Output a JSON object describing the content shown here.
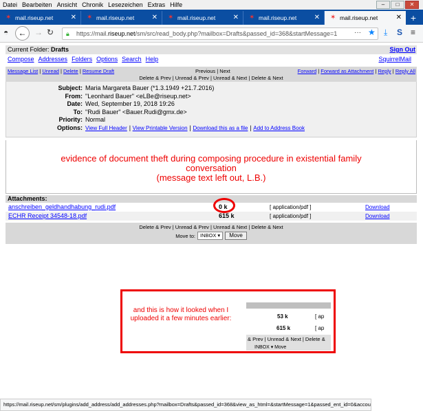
{
  "menu": [
    "Datei",
    "Bearbeiten",
    "Ansicht",
    "Chronik",
    "Lesezeichen",
    "Extras",
    "Hilfe"
  ],
  "tabs": [
    "mail.riseup.net",
    "mail.riseup.net",
    "mail.riseup.net",
    "mail.riseup.net",
    "mail.riseup.net"
  ],
  "url": {
    "prefix": "https://mail.",
    "domain": "riseup.net",
    "path": "/sm/src/read_body.php?mailbox=Drafts&passed_id=368&startMessage=1"
  },
  "folder": {
    "label": "Current Folder: ",
    "name": "Drafts",
    "signout": "Sign Out"
  },
  "topnav": [
    "Compose",
    "Addresses",
    "Folders",
    "Options",
    "Search",
    "Help"
  ],
  "squirrelmail": "SquirrelMail",
  "msgnav": {
    "left": [
      "Message List",
      "Unread",
      "Delete",
      "Resume Draft"
    ],
    "middle": "Previous | Next",
    "right": [
      "Forward",
      "Forward as Attachment",
      "Reply",
      "Reply All"
    ],
    "row2": "Delete & Prev | Unread & Prev | Unread & Next | Delete & Next"
  },
  "headers": {
    "subject_k": "Subject:",
    "subject": "Maria Margareta Bauer (*1.3.1949 +21.7.2016)",
    "from_k": "From:",
    "from": "\"Leonhard Bauer\" <eLBe@riseup.net>",
    "date_k": "Date:",
    "date": "Wed, September 19, 2018 19:26",
    "to_k": "To:",
    "to": "\"Rudi Bauer\" <Bauer.Rudi@gmx.de>",
    "priority_k": "Priority:",
    "priority": "Normal",
    "options_k": "Options:",
    "options": [
      "View Full Header",
      "View Printable Version",
      "Download this as a file",
      "Add to Address Book"
    ]
  },
  "evidence": [
    "evidence of document theft during composing procedure in existential family",
    "conversation",
    "(message text left out, L.B.)"
  ],
  "attachments": {
    "title": "Attachments:",
    "rows": [
      {
        "name": "anschreiben_geldhandhabung_rudi.pdf",
        "size": "0 k",
        "type": "[ application/pdf ]",
        "action": "Download"
      },
      {
        "name": "ECHR Receipt 34548-18.pdf",
        "size": "615 k",
        "type": "[ application/pdf ]",
        "action": "Download"
      }
    ]
  },
  "bottom": {
    "nav": "Delete & Prev | Unread & Prev | Unread & Next | Delete & Next",
    "moveto": "Move to:",
    "folder": "INBOX",
    "button": "Move"
  },
  "note": {
    "text": "and this is how it looked when I uploaded it a few minutes earlier:",
    "snip_row1": "53 k",
    "snip_row2": "615 k",
    "snip_type": "[ ap",
    "snip_nav": "& Prev | Unread & Next | Delete &",
    "snip_sel": "INBOX ▾   Move"
  },
  "status": "https://mail.riseup.net/sm/plugins/add_address/add_addresses.php?mailbox=Drafts&passed_id=368&view_as_html=&startMessage=1&passed_ent_id=0&account="
}
